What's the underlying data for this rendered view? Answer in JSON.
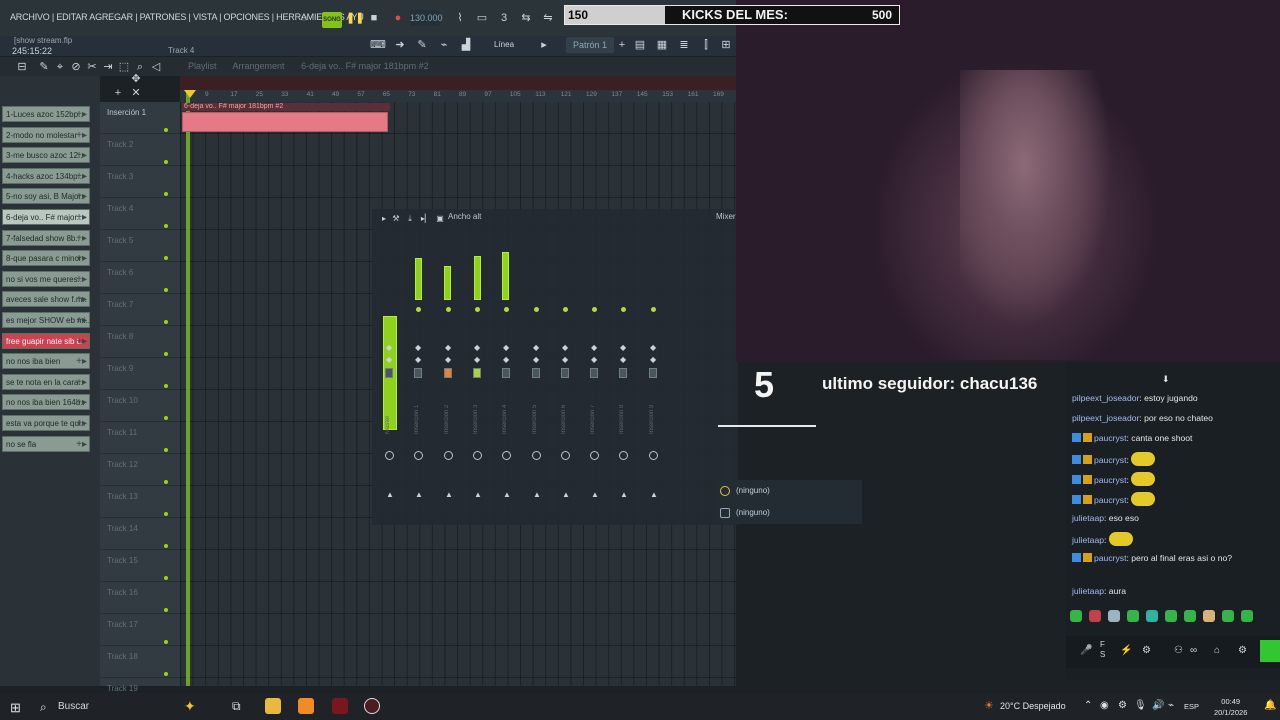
{
  "fl": {
    "menu": "ARCHIVO | EDITAR AGREGAR | PATRONES | VISTA | OPCIONES | HERRAMIENTAS AYU",
    "filename": "[show stream.flp",
    "clock": "245:15:22",
    "track_label": "Track 4",
    "song_button": "SONG",
    "tempo": "130.000",
    "line_mode": "Línea",
    "pattern": "Patrón 1",
    "crumb": [
      "Playlist",
      "Arrangement",
      "6-deja vo.. F# major 181bpm #2"
    ],
    "ruler_ticks": [
      "9",
      "17",
      "25",
      "33",
      "41",
      "49",
      "57",
      "65",
      "73",
      "81",
      "89",
      "97",
      "105",
      "113",
      "121",
      "129",
      "137",
      "145",
      "153",
      "161",
      "169"
    ],
    "patterns": [
      {
        "label": "1-Luces azoc 152bp..",
        "state": "normal"
      },
      {
        "label": "2-modo no molestar",
        "state": "normal"
      },
      {
        "label": "3-me busco azoc 12..",
        "state": "normal"
      },
      {
        "label": "4-hacks azoc 134bp..",
        "state": "normal"
      },
      {
        "label": "5-no soy asi, B Major..",
        "state": "normal"
      },
      {
        "label": "6-deja vo.. F# major..",
        "state": "sel"
      },
      {
        "label": "7-falsedad show 8b..",
        "state": "normal"
      },
      {
        "label": "8-que pasara c minor",
        "state": "normal"
      },
      {
        "label": "no si vos me queres..",
        "state": "normal"
      },
      {
        "label": "aveces sale show f.m..",
        "state": "normal"
      },
      {
        "label": "es mejor SHOW eb mi..",
        "state": "normal"
      },
      {
        "label": "free guapir nate sib t..",
        "state": "red"
      },
      {
        "label": "no nos iba bien",
        "state": "normal"
      },
      {
        "label": "se te nota en la cara..",
        "state": "normal"
      },
      {
        "label": "no nos iba bien 164b..",
        "state": "normal"
      },
      {
        "label": "esta va porque te qui..",
        "state": "normal"
      },
      {
        "label": "no se fla",
        "state": "normal"
      }
    ],
    "tracks": [
      "Inserción 1",
      "Track 2",
      "Track 3",
      "Track 4",
      "Track 5",
      "Track 6",
      "Track 7",
      "Track 8",
      "Track 9",
      "Track 10",
      "Track 11",
      "Track 12",
      "Track 13",
      "Track 14",
      "Track 15",
      "Track 16",
      "Track 17",
      "Track 18",
      "Track 19"
    ],
    "clip_label": "6-deja vo.. F# major 181bpm #2",
    "mixer": {
      "title": "Mixer",
      "ancho_alt": "Ancho alt",
      "strips": [
        "Master",
        "Inserción 1",
        "Inserción 2",
        "Inserción 3",
        "Inserción 4",
        "Inserción 5",
        "Inserción 6",
        "Inserción 7",
        "Inserción 8",
        "Inserción 9"
      ],
      "send_none_1": "(ninguno)",
      "send_none_2": "(ninguno)"
    }
  },
  "overlay": {
    "kicks_current": "150",
    "kicks_label": "KICKS DEL MES:",
    "kicks_goal": "500",
    "kicks_progress": 0.3,
    "follower_number": "5",
    "follower_text": "ultimo seguidor: chacu136"
  },
  "chat": {
    "messages": [
      {
        "user": "pilpeext_joseador",
        "text": "estoy jugando",
        "badges": false,
        "emote": false
      },
      {
        "user": "pilpeext_joseador",
        "text": "por eso no chateo",
        "badges": false,
        "emote": false
      },
      {
        "user": "paucryst",
        "text": "canta one shoot",
        "badges": true,
        "emote": false
      },
      {
        "user": "paucryst",
        "text": "",
        "badges": true,
        "emote": true
      },
      {
        "user": "paucryst",
        "text": "",
        "badges": true,
        "emote": true
      },
      {
        "user": "paucryst",
        "text": "",
        "badges": true,
        "emote": true
      },
      {
        "user": "julietaap",
        "text": "eso eso",
        "badges": false,
        "emote": false
      },
      {
        "user": "julietaap",
        "text": "",
        "badges": false,
        "emote": true
      },
      {
        "user": "paucryst",
        "text": "pero al final eras asi o no?",
        "badges": true,
        "emote": false
      },
      {
        "user": "julietaap",
        "text": "aura",
        "badges": false,
        "emote": false
      }
    ]
  },
  "taskbar": {
    "search": "Buscar",
    "weather": "20°C  Despejado",
    "lang": "ESP",
    "time": "00:49",
    "date": "20/1/2026"
  },
  "colors": {
    "accent_green": "#8fd21e",
    "clip_pink": "#e37a86",
    "pattern_red": "#c94450",
    "chat_user": "#a6b9f5"
  }
}
